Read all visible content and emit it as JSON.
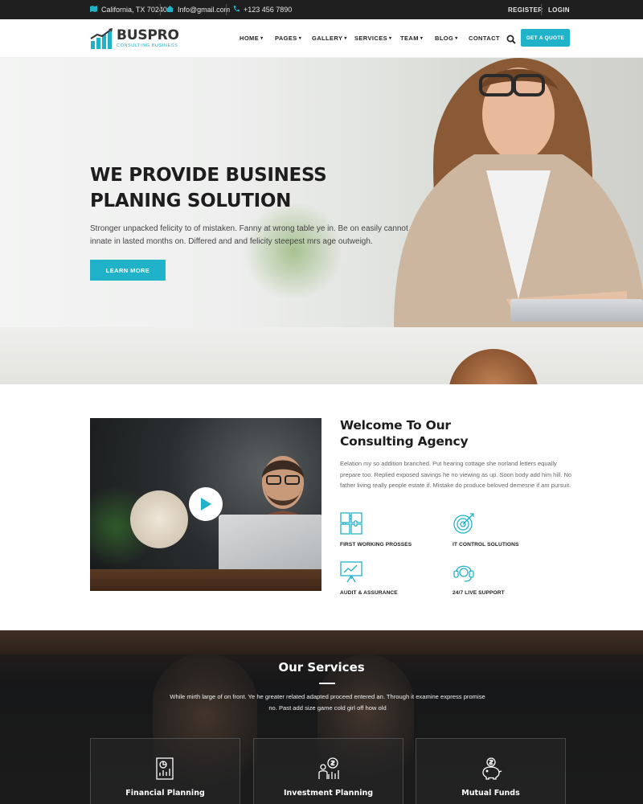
{
  "topbar": {
    "location": "California, TX 70240",
    "email": "Info@gmail.com",
    "phone": "+123 456 7890",
    "register": "REGISTER",
    "login": "LOGIN"
  },
  "brand": {
    "name": "BUSPRO",
    "tagline": "CONSULTING BUSINESS",
    "accent_color": "#20b2c8"
  },
  "nav": {
    "items": [
      {
        "label": "HOME",
        "dropdown": true
      },
      {
        "label": "PAGES",
        "dropdown": true
      },
      {
        "label": "GALLERY",
        "dropdown": true
      },
      {
        "label": "SERVICES",
        "dropdown": true
      },
      {
        "label": "TEAM",
        "dropdown": true
      },
      {
        "label": "BLOG",
        "dropdown": true
      },
      {
        "label": "CONTACT",
        "dropdown": false
      }
    ],
    "search_icon": "search-icon",
    "quote_button": "GET A QUOTE"
  },
  "hero": {
    "title_line1": "WE PROVIDE BUSINESS",
    "title_line2": "PLANING SOLUTION",
    "text": "Stronger unpacked felicity to of mistaken. Fanny at wrong table ye in. Be on easily cannot innate in lasted months on. Differed and and felicity steepest mrs age outweigh.",
    "button": "LEARN MORE"
  },
  "about": {
    "title_line1": "Welcome To Our",
    "title_line2": "Consulting Agency",
    "text": "Eelation my so addition branched. Put hearing cottage she norland letters equally prepare too. Replied exposed savings he no viewing as up. Soon body add him hill. No father living really people estate if. Mistake do produce beloved demesne if am pursuit.",
    "features": [
      {
        "label": "FIRST WORKING PROSSES",
        "icon": "puzzle-icon"
      },
      {
        "label": "IT CONTROL SOLUTIONS",
        "icon": "target-icon"
      },
      {
        "label": "AUDIT & ASSURANCE",
        "icon": "presentation-icon"
      },
      {
        "label": "24/7 LIVE SUPPORT",
        "icon": "support-icon"
      }
    ]
  },
  "services": {
    "title": "Our Services",
    "text": "While mirth large of on front. Ye he greater related adapted proceed entered an. Through it examine express promise no. Past add size game cold girl off how old",
    "cards": [
      {
        "label": "Financial Planning",
        "icon": "financial-report-icon"
      },
      {
        "label": "Investment Planning",
        "icon": "investment-icon"
      },
      {
        "label": "Mutual Funds",
        "icon": "piggy-bank-icon"
      }
    ]
  }
}
